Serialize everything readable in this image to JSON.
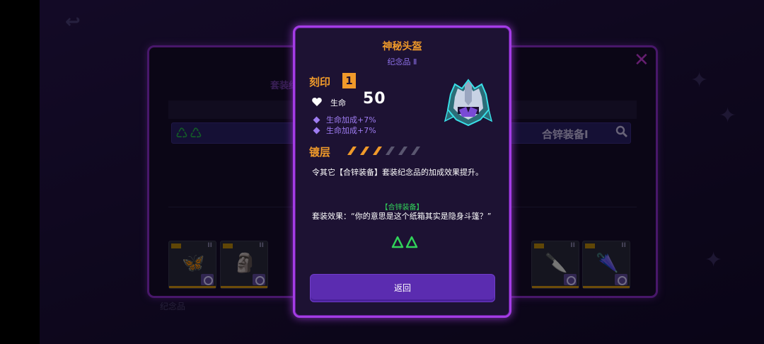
{
  "background": {
    "back_glyph": "↩",
    "panel": {
      "heading": "套装纪念品是什么？",
      "close_glyph": "✕",
      "set_bar": {
        "icons": "♺♺",
        "label": "合锌装备I"
      },
      "tab_label": "纪念品",
      "cards": [
        {
          "roman": "II",
          "emblem": "🦋",
          "color": "#d9a640"
        },
        {
          "roman": "II",
          "emblem": "🗿",
          "color": "#c8a640"
        },
        {
          "roman": "II",
          "emblem": "🔪",
          "color": "#c98a3a"
        },
        {
          "roman": "II",
          "emblem": "🌂",
          "color": "#c98a3a"
        }
      ]
    }
  },
  "popup": {
    "title": "神秘头盔",
    "subtitle": "纪念品 Ⅱ",
    "inscription": {
      "label": "刻印",
      "level": "1"
    },
    "stat": {
      "label": "生命",
      "value": "50"
    },
    "bonuses": [
      "生命加成+7%",
      "生命加成+7%"
    ],
    "plating": {
      "label": "镀层",
      "filled": 3,
      "total": 6
    },
    "description": "令其它【合锌装备】套装纪念品的加成效果提升。",
    "set_name": "【合锌装备】",
    "set_effect": "套装效果：“你的意思是这个纸箱其实是隐身斗篷？”",
    "return_label": "返回"
  },
  "colors": {
    "accent_orange": "#f09a2a",
    "accent_purple": "#a43ce6",
    "bonus_purple": "#9e7cf1",
    "set_green": "#31d35a"
  }
}
